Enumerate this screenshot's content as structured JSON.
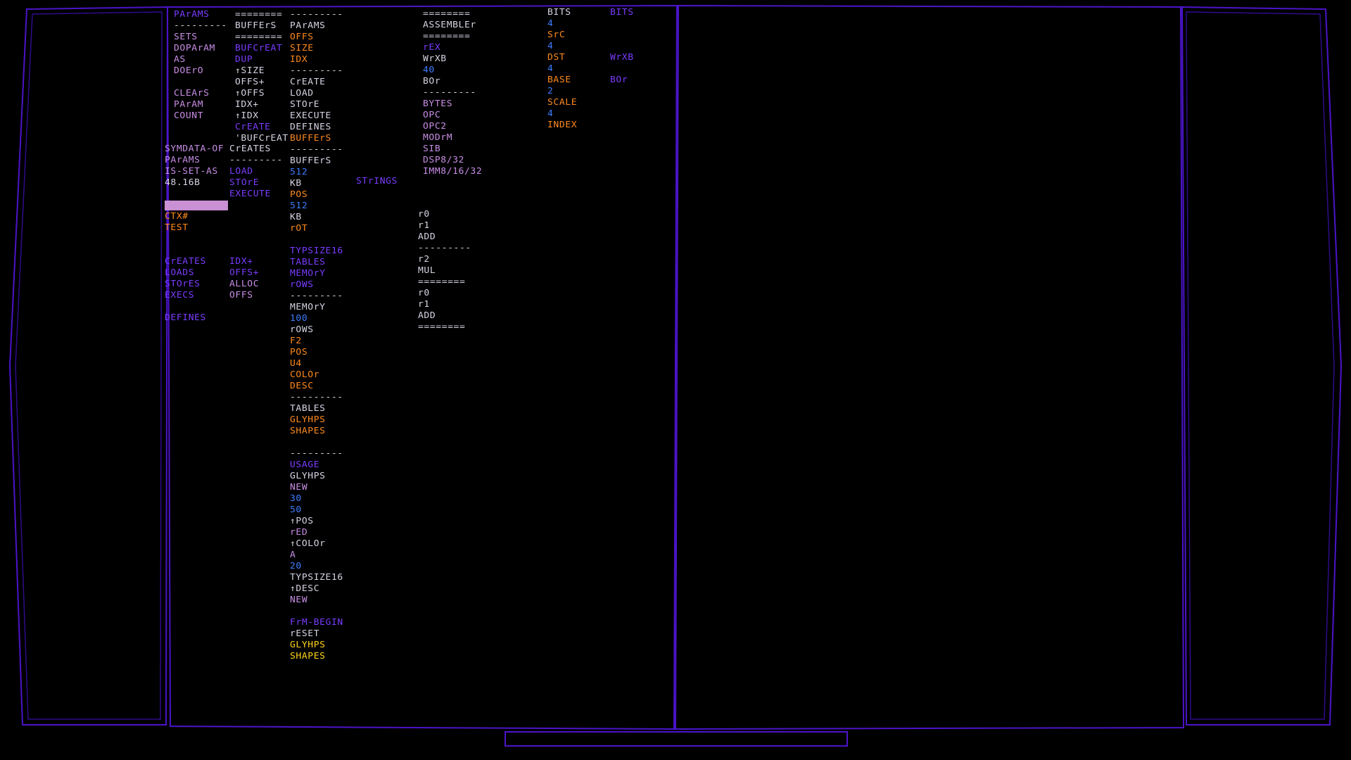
{
  "colors": {
    "white": "#d9d4e4",
    "violet": "#7a3cff",
    "magenta": "#c98ee6",
    "orange": "#ff8a1e",
    "blue": "#3d7dff",
    "yellow": "#ffd21a",
    "frame": "#4b14c8",
    "cursor": "#c990d4"
  },
  "columns": [
    {
      "id": "col-1a",
      "lines": [
        {
          "t": "PArAMS",
          "c": "violet"
        },
        {
          "t": "---------",
          "c": "white"
        },
        {
          "t": "SETS",
          "c": "magenta"
        },
        {
          "t": "DOPArAM",
          "c": "magenta"
        },
        {
          "t": "AS",
          "c": "magenta"
        },
        {
          "t": "DOErO",
          "c": "magenta"
        },
        {
          "t": "",
          "c": "white"
        },
        {
          "t": "CLEArS",
          "c": "magenta"
        },
        {
          "t": "PArAM",
          "c": "magenta"
        },
        {
          "t": "COUNT",
          "c": "magenta"
        }
      ]
    },
    {
      "id": "col-1b",
      "lines": [
        {
          "t": "SYMDATA-OF",
          "c": "magenta"
        },
        {
          "t": "PArAMS",
          "c": "magenta"
        },
        {
          "t": "IS-SET-AS",
          "c": "magenta"
        },
        {
          "t": "48.16B",
          "c": "white"
        },
        {
          "t": "",
          "c": "white"
        },
        {
          "t": "",
          "c": "cursor"
        },
        {
          "t": "CTX#",
          "c": "orange"
        },
        {
          "t": "TEST",
          "c": "orange"
        },
        {
          "t": "",
          "c": "white"
        },
        {
          "t": "",
          "c": "white"
        },
        {
          "t": "CrEATES",
          "c": "violet"
        },
        {
          "t": "LOADS",
          "c": "violet"
        },
        {
          "t": "STOrES",
          "c": "violet"
        },
        {
          "t": "EXECS",
          "c": "violet"
        },
        {
          "t": "",
          "c": "white"
        },
        {
          "t": "DEFINES",
          "c": "violet"
        }
      ]
    },
    {
      "id": "col-2a",
      "lines": [
        {
          "t": "========",
          "c": "white"
        },
        {
          "t": "BUFFErS",
          "c": "white"
        },
        {
          "t": "========",
          "c": "white"
        },
        {
          "t": "BUFCrEAT",
          "c": "violet"
        },
        {
          "t": "DUP",
          "c": "violet"
        },
        {
          "t": "↑SIZE",
          "c": "white"
        },
        {
          "t": "OFFS+",
          "c": "white"
        },
        {
          "t": "↑OFFS",
          "c": "white"
        },
        {
          "t": "IDX+",
          "c": "white"
        },
        {
          "t": "↑IDX",
          "c": "white"
        },
        {
          "t": "CrEATE",
          "c": "violet"
        },
        {
          "t": "'BUFCrEAT",
          "c": "white"
        }
      ]
    },
    {
      "id": "col-2b",
      "lines": [
        {
          "t": "CrEATES",
          "c": "white"
        },
        {
          "t": "---------",
          "c": "white"
        },
        {
          "t": "LOAD",
          "c": "violet"
        },
        {
          "t": "STOrE",
          "c": "violet"
        },
        {
          "t": "EXECUTE",
          "c": "violet"
        },
        {
          "t": "",
          "c": "white"
        },
        {
          "t": "",
          "c": "white"
        },
        {
          "t": "",
          "c": "white"
        },
        {
          "t": "",
          "c": "white"
        },
        {
          "t": "",
          "c": "white"
        },
        {
          "t": "IDX+",
          "c": "violet"
        },
        {
          "t": "OFFS+",
          "c": "violet"
        },
        {
          "t": "ALLOC",
          "c": "magenta"
        },
        {
          "t": "OFFS",
          "c": "magenta"
        }
      ]
    },
    {
      "id": "col-3",
      "lines": [
        {
          "t": "---------",
          "c": "white"
        },
        {
          "t": "PArAMS",
          "c": "white"
        },
        {
          "t": "OFFS",
          "c": "orange"
        },
        {
          "t": "SIZE",
          "c": "orange"
        },
        {
          "t": "IDX",
          "c": "orange"
        },
        {
          "t": "---------",
          "c": "white"
        },
        {
          "t": "CrEATE",
          "c": "white"
        },
        {
          "t": "LOAD",
          "c": "white"
        },
        {
          "t": "STOrE",
          "c": "white"
        },
        {
          "t": "EXECUTE",
          "c": "white"
        },
        {
          "t": "DEFINES",
          "c": "white"
        },
        {
          "t": "BUFFErS",
          "c": "orange"
        },
        {
          "t": "---------",
          "c": "white"
        },
        {
          "t": "BUFFErS",
          "c": "white"
        },
        {
          "t": "512",
          "c": "blue"
        },
        {
          "t": "KB",
          "c": "white"
        },
        {
          "t": "POS",
          "c": "orange"
        },
        {
          "t": "512",
          "c": "blue"
        },
        {
          "t": "KB",
          "c": "white"
        },
        {
          "t": "rOT",
          "c": "orange"
        },
        {
          "t": "",
          "c": "white"
        },
        {
          "t": "TYPSIZE16",
          "c": "violet"
        },
        {
          "t": "TABLES",
          "c": "violet"
        },
        {
          "t": "MEMOrY",
          "c": "violet"
        },
        {
          "t": "rOWS",
          "c": "violet"
        },
        {
          "t": "---------",
          "c": "white"
        },
        {
          "t": "MEMOrY",
          "c": "white"
        },
        {
          "t": "100",
          "c": "blue"
        },
        {
          "t": "rOWS",
          "c": "white"
        },
        {
          "t": "F2",
          "c": "orange"
        },
        {
          "t": "POS",
          "c": "orange"
        },
        {
          "t": "U4",
          "c": "orange"
        },
        {
          "t": "COLOr",
          "c": "orange"
        },
        {
          "t": "DESC",
          "c": "orange"
        },
        {
          "t": "---------",
          "c": "white"
        },
        {
          "t": "TABLES",
          "c": "white"
        },
        {
          "t": "GLYHPS",
          "c": "orange"
        },
        {
          "t": "SHAPES",
          "c": "orange"
        },
        {
          "t": "",
          "c": "white"
        },
        {
          "t": "---------",
          "c": "white"
        },
        {
          "t": "USAGE",
          "c": "violet"
        },
        {
          "t": "GLYHPS",
          "c": "white"
        },
        {
          "t": "NEW",
          "c": "magenta"
        },
        {
          "t": "30",
          "c": "blue"
        },
        {
          "t": "50",
          "c": "blue"
        },
        {
          "t": "↑POS",
          "c": "white"
        },
        {
          "t": "rED",
          "c": "magenta"
        },
        {
          "t": "↑COLOr",
          "c": "white"
        },
        {
          "t": "A",
          "c": "magenta"
        },
        {
          "t": "20",
          "c": "blue"
        },
        {
          "t": "TYPSIZE16",
          "c": "white"
        },
        {
          "t": "↑DESC",
          "c": "white"
        },
        {
          "t": "NEW",
          "c": "magenta"
        },
        {
          "t": "",
          "c": "white"
        },
        {
          "t": "FrM-BEGIN",
          "c": "violet"
        },
        {
          "t": "rESET",
          "c": "white"
        },
        {
          "t": "GLYHPS",
          "c": "yellow"
        },
        {
          "t": "SHAPES",
          "c": "yellow"
        }
      ]
    },
    {
      "id": "col-strings",
      "lines": [
        {
          "t": "STrINGS",
          "c": "violet"
        }
      ]
    },
    {
      "id": "col-4a",
      "lines": [
        {
          "t": "========",
          "c": "white"
        },
        {
          "t": "ASSEMBLEr",
          "c": "white"
        },
        {
          "t": "========",
          "c": "white"
        },
        {
          "t": "rEX",
          "c": "violet"
        },
        {
          "t": "WrXB",
          "c": "white"
        },
        {
          "t": "40",
          "c": "blue"
        },
        {
          "t": "BOr",
          "c": "white"
        },
        {
          "t": "---------",
          "c": "white"
        },
        {
          "t": "BYTES",
          "c": "magenta"
        },
        {
          "t": "OPC",
          "c": "magenta"
        },
        {
          "t": "OPC2",
          "c": "magenta"
        },
        {
          "t": "MODrM",
          "c": "magenta"
        },
        {
          "t": "SIB",
          "c": "magenta"
        },
        {
          "t": "DSP8/32",
          "c": "magenta"
        },
        {
          "t": "IMM8/16/32",
          "c": "magenta"
        }
      ]
    },
    {
      "id": "col-4b",
      "lines": [
        {
          "t": "r0",
          "c": "white"
        },
        {
          "t": "r1",
          "c": "white"
        },
        {
          "t": "ADD",
          "c": "white"
        },
        {
          "t": "---------",
          "c": "white"
        },
        {
          "t": "r2",
          "c": "white"
        },
        {
          "t": "MUL",
          "c": "white"
        },
        {
          "t": "========",
          "c": "white"
        },
        {
          "t": "r0",
          "c": "white"
        },
        {
          "t": "r1",
          "c": "white"
        },
        {
          "t": "ADD",
          "c": "white"
        },
        {
          "t": "========",
          "c": "white"
        }
      ]
    },
    {
      "id": "col-5",
      "lines": [
        {
          "t": "BITS",
          "c": "white"
        },
        {
          "t": "4",
          "c": "blue"
        },
        {
          "t": "SrC",
          "c": "orange"
        },
        {
          "t": "4",
          "c": "blue"
        },
        {
          "t": "DST",
          "c": "orange"
        },
        {
          "t": "4",
          "c": "blue"
        },
        {
          "t": "BASE",
          "c": "orange"
        },
        {
          "t": "2",
          "c": "blue"
        },
        {
          "t": "SCALE",
          "c": "orange"
        },
        {
          "t": "4",
          "c": "blue"
        },
        {
          "t": "INDEX",
          "c": "orange"
        }
      ]
    },
    {
      "id": "col-6",
      "lines": [
        {
          "t": "BITS",
          "c": "violet"
        },
        {
          "t": "",
          "c": "white"
        },
        {
          "t": "",
          "c": "white"
        },
        {
          "t": "",
          "c": "white"
        },
        {
          "t": "WrXB",
          "c": "violet"
        },
        {
          "t": "",
          "c": "white"
        },
        {
          "t": "BOr",
          "c": "violet"
        }
      ]
    }
  ]
}
